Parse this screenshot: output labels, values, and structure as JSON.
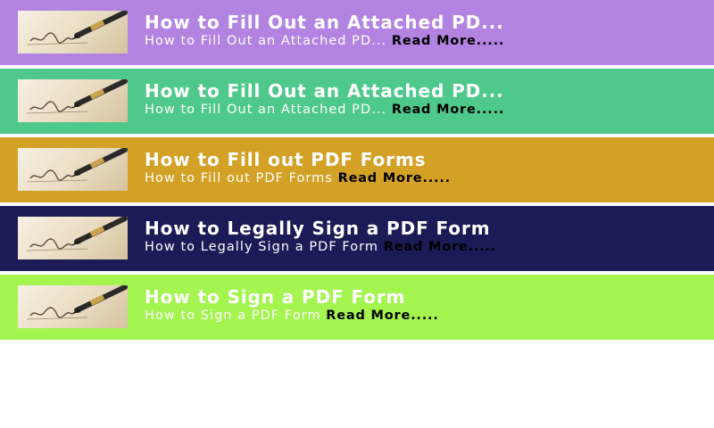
{
  "colors": {
    "page_background": "#ffffff",
    "card_1": "#b283e0",
    "card_2": "#4fc98b",
    "card_3": "#d4a127",
    "card_4": "#1b1b57",
    "card_5": "#a4f54f",
    "title_text": "#ffffff",
    "read_more_text": "#000000"
  },
  "articles": [
    {
      "title": "How to Fill Out an Attached PD...",
      "excerpt": "How to Fill Out an Attached PD...",
      "read_more": "Read More.....",
      "thumbnail_icon": "pen-signing-icon",
      "color": "#b283e0"
    },
    {
      "title": "How to Fill Out an Attached PD...",
      "excerpt": "How to Fill Out an Attached PD...",
      "read_more": "Read More.....",
      "thumbnail_icon": "pen-signing-icon",
      "color": "#4fc98b"
    },
    {
      "title": "How to Fill out PDF Forms",
      "excerpt": "How to Fill out PDF Forms",
      "read_more": "Read More.....",
      "thumbnail_icon": "pen-signing-icon",
      "color": "#d4a127"
    },
    {
      "title": "How to Legally Sign a PDF Form",
      "excerpt": "How to Legally Sign a PDF Form",
      "read_more": "Read More.....",
      "thumbnail_icon": "pen-signing-icon",
      "color": "#1b1b57"
    },
    {
      "title": "How to Sign a PDF Form",
      "excerpt": "How to Sign a PDF Form",
      "read_more": "Read More.....",
      "thumbnail_icon": "pen-signing-icon",
      "color": "#a4f54f"
    }
  ]
}
